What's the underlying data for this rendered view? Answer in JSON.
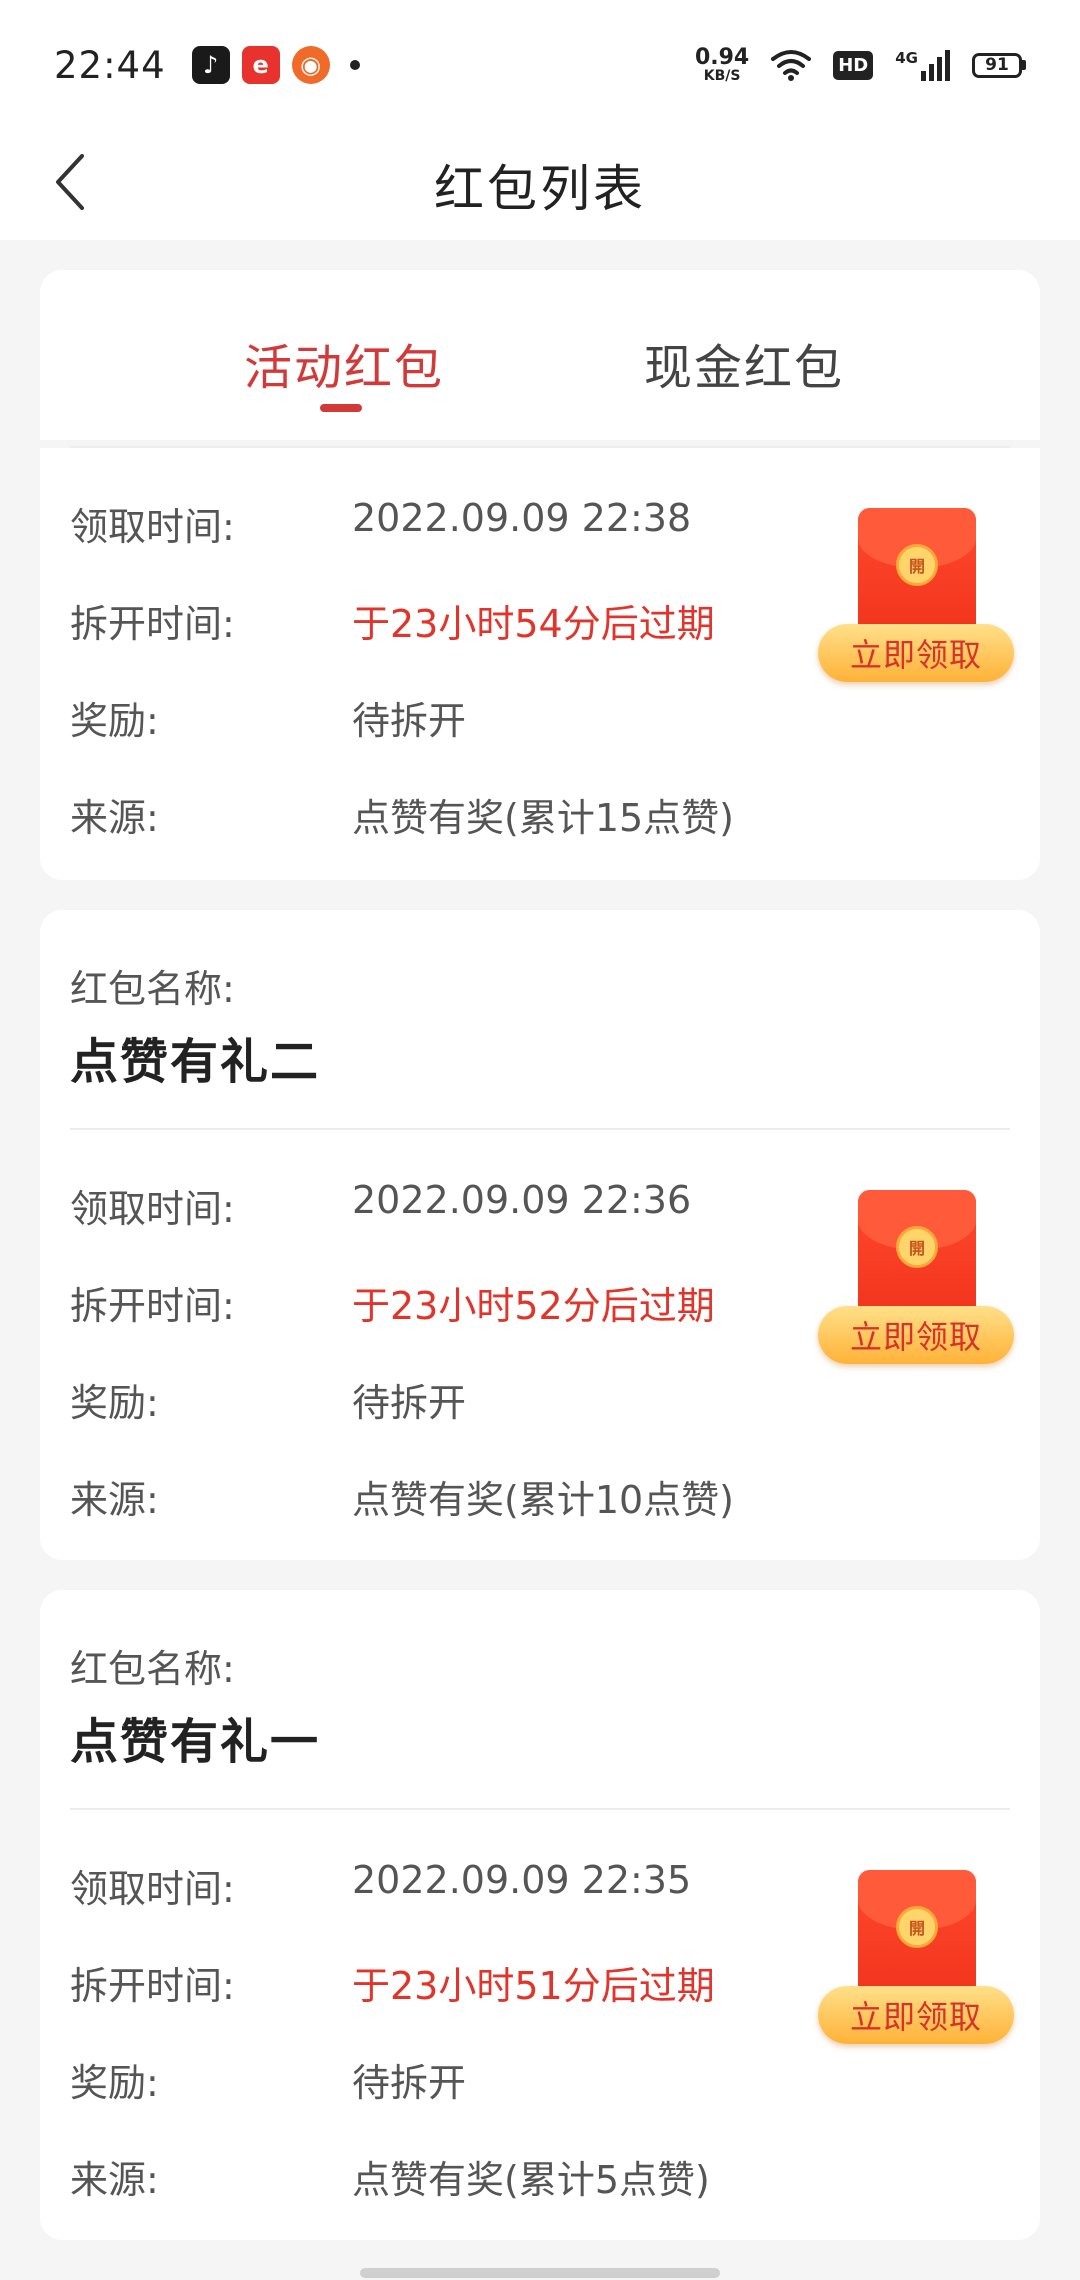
{
  "status_bar": {
    "time": "22:44",
    "net_speed_value": "0.94",
    "net_speed_unit": "KB/S",
    "hd_label": "HD",
    "signal_label": "4G",
    "battery": "91",
    "icons": [
      "tiktok-icon",
      "app-e-icon",
      "app-bag-icon",
      "notification-dot"
    ]
  },
  "header": {
    "title": "红包列表",
    "back_icon": "chevron-left-icon"
  },
  "tabs": [
    {
      "label": "活动红包",
      "active": true
    },
    {
      "label": "现金红包",
      "active": false
    }
  ],
  "labels": {
    "name": "红包名称:",
    "received_time": "领取时间:",
    "open_time": "拆开时间:",
    "reward": "奖励:",
    "source": "来源:"
  },
  "envelope": {
    "seal_text": "開",
    "claim_button": "立即领取"
  },
  "items": [
    {
      "received_time": "2022.09.09 22:38",
      "open_time": "于23小时54分后过期",
      "reward": "待拆开",
      "source": "点赞有奖(累计15点赞)"
    },
    {
      "name": "点赞有礼二",
      "received_time": "2022.09.09 22:36",
      "open_time": "于23小时52分后过期",
      "reward": "待拆开",
      "source": "点赞有奖(累计10点赞)"
    },
    {
      "name": "点赞有礼一",
      "received_time": "2022.09.09 22:35",
      "open_time": "于23小时51分后过期",
      "reward": "待拆开",
      "source": "点赞有奖(累计5点赞)"
    }
  ],
  "colors": {
    "accent_red": "#d23a3a",
    "expire_red": "#e0352b",
    "button_gold": "#ffb238",
    "background": "#f5f5f5"
  }
}
